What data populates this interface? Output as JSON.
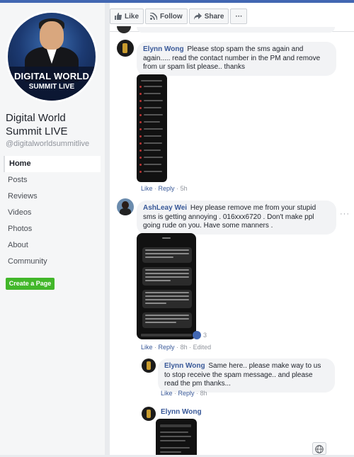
{
  "page": {
    "avatar_line1": "DIGITAL WORLD",
    "avatar_line2": "SUMMIT LIVE",
    "name": "Digital World Summit LIVE",
    "handle": "@digitalworldsummitlive"
  },
  "nav": {
    "items": [
      "Home",
      "Posts",
      "Reviews",
      "Videos",
      "Photos",
      "About",
      "Community"
    ],
    "active": "Home"
  },
  "create_page": "Create a Page",
  "actions": {
    "like": "Like",
    "follow": "Follow",
    "share": "Share",
    "more": "···"
  },
  "comments": [
    {
      "author": "Elynn Wong",
      "text": "Please stop spam the sms again and again..... read the contact number in the PM and remove from ur spam list please.. thanks",
      "like": "Like",
      "reply": "Reply",
      "time": "5h"
    },
    {
      "author": "AshLeay Wei",
      "text": "Hey please remove me from your stupid sms is getting annoying . 016xxx6720 . Don't make ppl going rude on you. Have some manners .",
      "like": "Like",
      "reply": "Reply",
      "time": "8h",
      "edited": "Edited",
      "reactions": "3"
    }
  ],
  "replies": [
    {
      "author": "Elynn Wong",
      "text": "Same here.. please make way to us to stop receive the spam message.. and please read the pm thanks...",
      "like": "Like",
      "reply": "Reply",
      "time": "8h"
    },
    {
      "author": "Elynn Wong"
    }
  ],
  "sep": "·",
  "colors": {
    "accent": "#4267b2",
    "link": "#385898",
    "create_button": "#42b72a"
  }
}
